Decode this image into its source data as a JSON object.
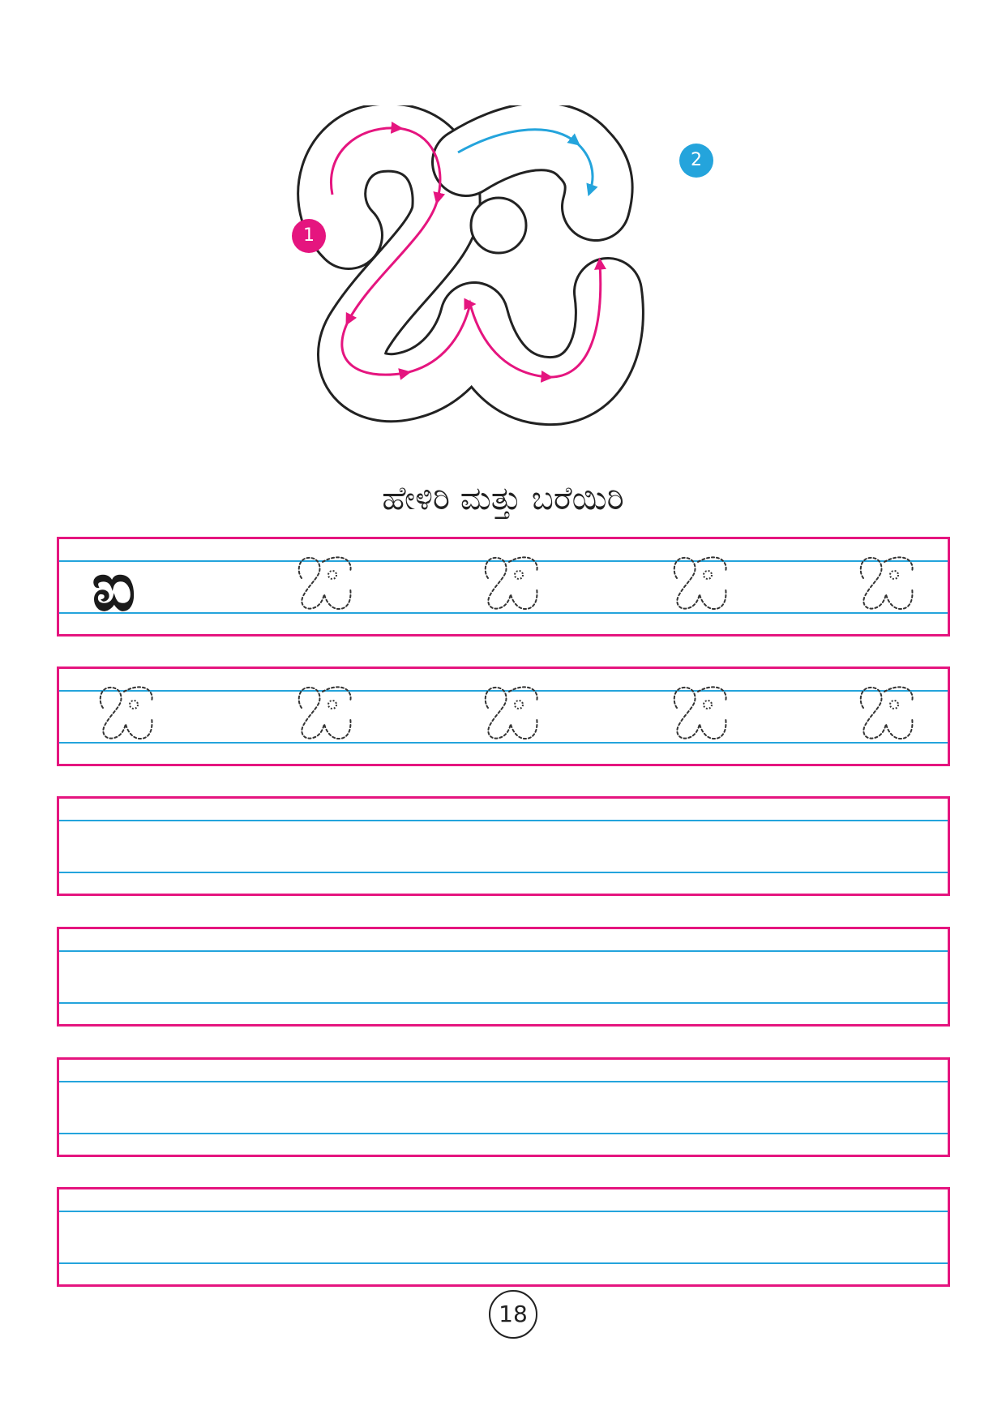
{
  "worksheet": {
    "letter": "ಐ",
    "step_badges": [
      "1",
      "2"
    ],
    "instruction": "ಹೇಳಿರಿ ಮತ್ತು ಬರೆಯಿರಿ",
    "page_number": "18",
    "practice": {
      "row_count": 6,
      "traced_rows": [
        [
          "solid",
          "dotted",
          "dotted",
          "dotted",
          "dotted"
        ],
        [
          "dotted",
          "dotted",
          "dotted",
          "dotted",
          "dotted"
        ]
      ]
    }
  },
  "colors": {
    "stroke_step_1": "#e5157f",
    "stroke_step_2": "#24a4dc",
    "row_border": "#e5157f",
    "guide_line": "#24a4dc",
    "outline": "#222222"
  },
  "icons": {
    "tracing_guide": "letter-tracing-guide-icon",
    "dotted_letter": "dotted-letter-icon"
  }
}
